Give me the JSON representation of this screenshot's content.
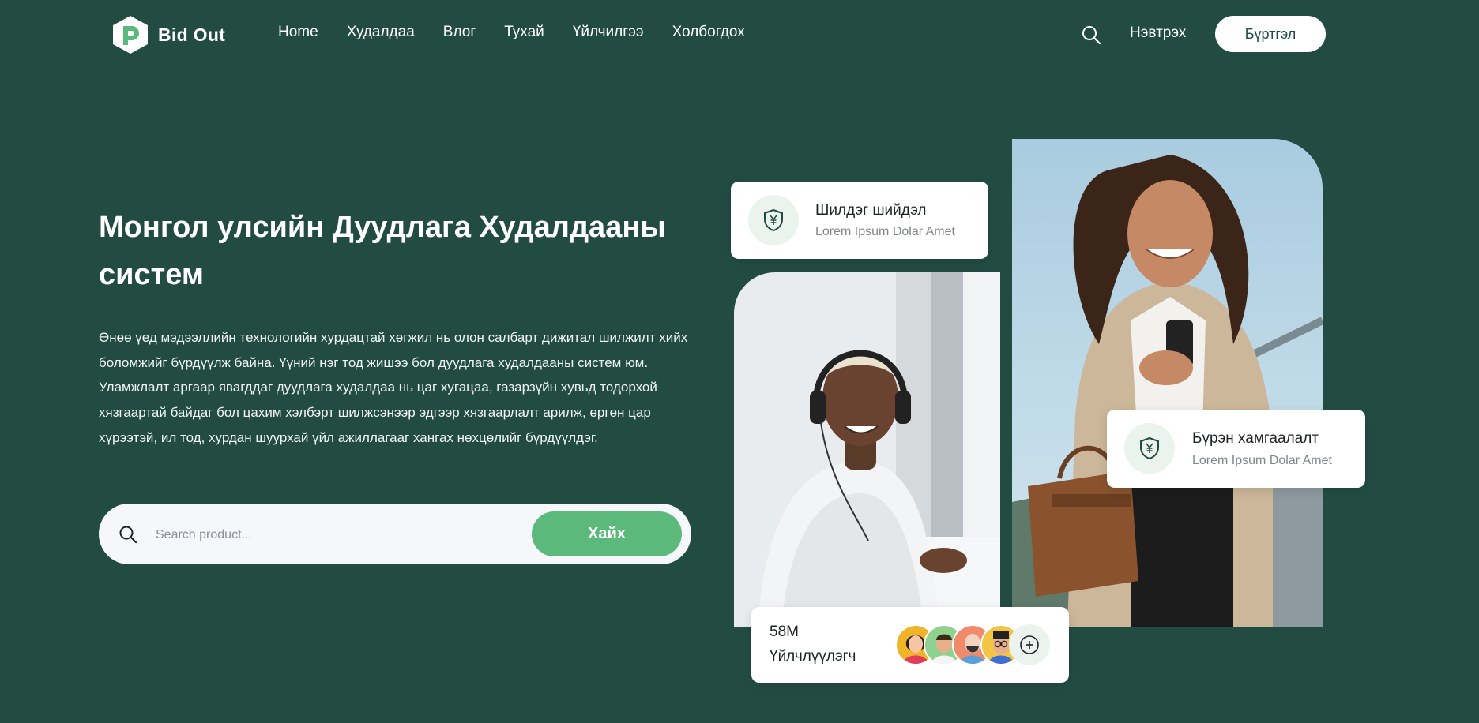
{
  "brand": {
    "name": "Bid Out"
  },
  "nav": {
    "items": [
      {
        "label": "Home"
      },
      {
        "label": "Худалдаа"
      },
      {
        "label": "Влог"
      },
      {
        "label": "Тухай"
      },
      {
        "label": "Үйлчилгээ"
      },
      {
        "label": "Холбогдох"
      }
    ]
  },
  "header": {
    "login_label": "Нэвтрэх",
    "signup_label": "Бүртгэл",
    "search_icon": "search-icon"
  },
  "hero": {
    "title": "Монгол улсийн Дуудлага Худалдааны систем",
    "description": "Өнөө үед мэдээллийн технологийн хурдацтай хөгжил нь олон салбарт дижитал шилжилт хийх боломжийг бүрдүүлж байна. Үүний нэг тод жишээ бол дуудлага худалдааны систем юм. Уламжлалт аргаар явагддаг дуудлага худалдаа нь цаг хугацаа, газарзүйн хувьд тодорхой хязгаартай байдаг бол цахим хэлбэрт шилжсэнээр эдгээр хязгаарлалт арилж, өргөн цар хүрээтэй, ил тод, хурдан шуурхай үйл ажиллагааг хангах нөхцөлийг бүрдүүлдэг.",
    "search": {
      "placeholder": "Search product...",
      "button_label": "Хайх"
    }
  },
  "cards": {
    "shield": {
      "title": "Шилдэг шийдэл",
      "subtitle": "Lorem Ipsum Dolar Amet",
      "icon": "shield-yen-icon"
    },
    "protection": {
      "title": "Бүрэн хамгаалалт",
      "subtitle": "Lorem Ipsum Dolar Amet",
      "icon": "shield-yen-icon"
    },
    "users": {
      "count": "58M",
      "label": "Үйлчлүүлэгч",
      "add_icon": "plus-circle-icon"
    }
  },
  "colors": {
    "background": "#224c42",
    "accent_green": "#5bba7b",
    "card_icon_bg": "#eaf3ee",
    "white": "#ffffff"
  }
}
